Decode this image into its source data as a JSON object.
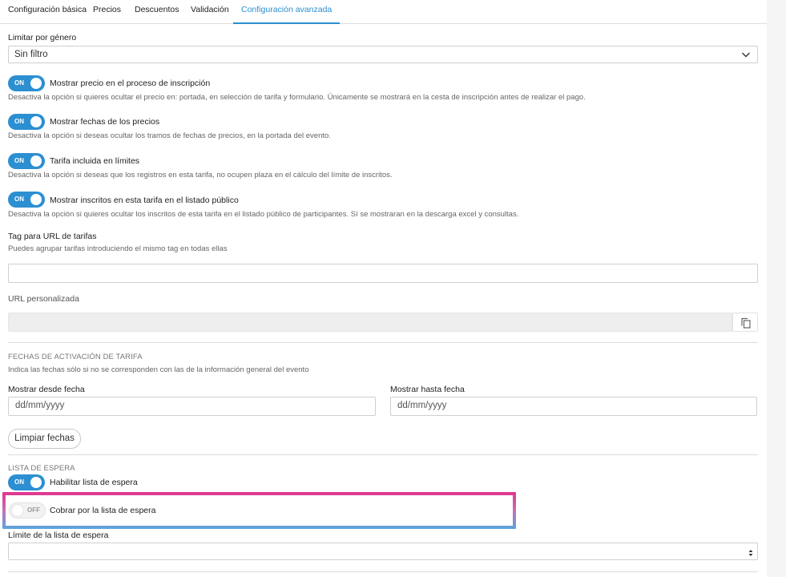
{
  "tabs": [
    {
      "label": "Configuración básica",
      "active": false
    },
    {
      "label": "Precios",
      "active": false
    },
    {
      "label": "Descuentos",
      "active": false
    },
    {
      "label": "Validación",
      "active": false
    },
    {
      "label": "Configuración avanzada",
      "active": true
    }
  ],
  "gender": {
    "label": "Limitar por género",
    "value": "Sin filtro"
  },
  "toggles": [
    {
      "state": "ON",
      "label": "Mostrar precio en el proceso de inscripción",
      "help": "Desactiva la opción si quieres ocultar el precio en: portada, en selección de tarifa y formulario. Únicamente se mostrará en la cesta de inscripción antes de realizar el pago."
    },
    {
      "state": "ON",
      "label": "Mostrar fechas de los precios",
      "help": "Desactiva la opción si deseas ocultar los tramos de fechas de precios, en la portada del evento."
    },
    {
      "state": "ON",
      "label": "Tarifa incluida en límites",
      "help": "Desactiva la opción si deseas que los registros en esta tarifa, no ocupen plaza en el cálculo del límite de inscritos."
    },
    {
      "state": "ON",
      "label": "Mostrar inscritos en esta tarifa en el listado público",
      "help": "Desactiva la opción si quieres ocultar los inscritos de esta tarifa en el listado público de participantes. Sí se mostraran en la descarga excel y consultas."
    }
  ],
  "tag": {
    "label": "Tag para URL de tarifas",
    "help": "Puedes agrupar tarifas introduciendo el mismo tag en todas ellas",
    "value": ""
  },
  "custom_url": {
    "label": "URL personalizada",
    "value": ""
  },
  "activation": {
    "title": "FECHAS DE ACTIVACIÓN DE TARIFA",
    "help": "Indica las fechas sólo si no se corresponden con las de la información general del evento",
    "from_label": "Mostrar desde fecha",
    "from_placeholder": "dd/mm/yyyy",
    "to_label": "Mostrar hasta fecha",
    "to_placeholder": "dd/mm/yyyy",
    "clear_button": "Limpiar fechas"
  },
  "waitlist": {
    "title": "LISTA DE ESPERA",
    "enable": {
      "state": "ON",
      "label": "Habilitar lista de espera"
    },
    "charge": {
      "state": "OFF",
      "label": "Cobrar por la lista de espera"
    },
    "limit_label": "Límite de la lista de espera",
    "limit_value": ""
  },
  "colors": {
    "accent": "#2b8fd1",
    "highlight_top": "#e2358f",
    "highlight_bottom": "#5aa6de"
  },
  "icons": [
    "chevron-down-icon",
    "copy-icon",
    "spinner-arrows-icon"
  ]
}
